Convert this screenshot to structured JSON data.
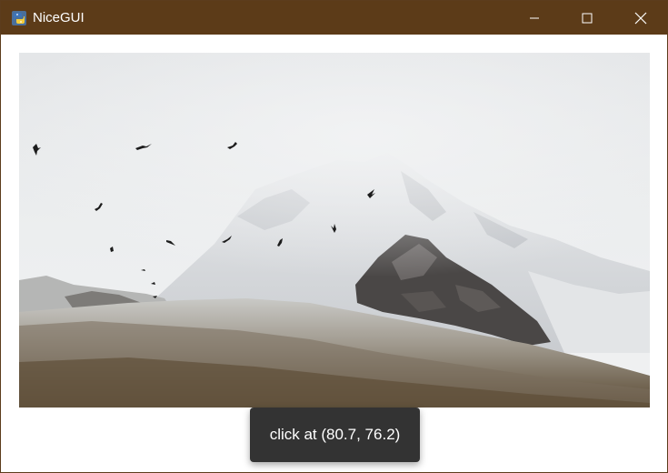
{
  "window": {
    "title": "NiceGUI",
    "app_icon": "python-icon",
    "controls": {
      "minimize": "minimize-icon",
      "maximize": "maximize-icon",
      "close": "close-icon"
    },
    "titlebar_color": "#5c3b18"
  },
  "main": {
    "image": {
      "subject": "snow-covered mountain with birds"
    },
    "notification": {
      "text": "click at (80.7, 76.2)"
    }
  }
}
